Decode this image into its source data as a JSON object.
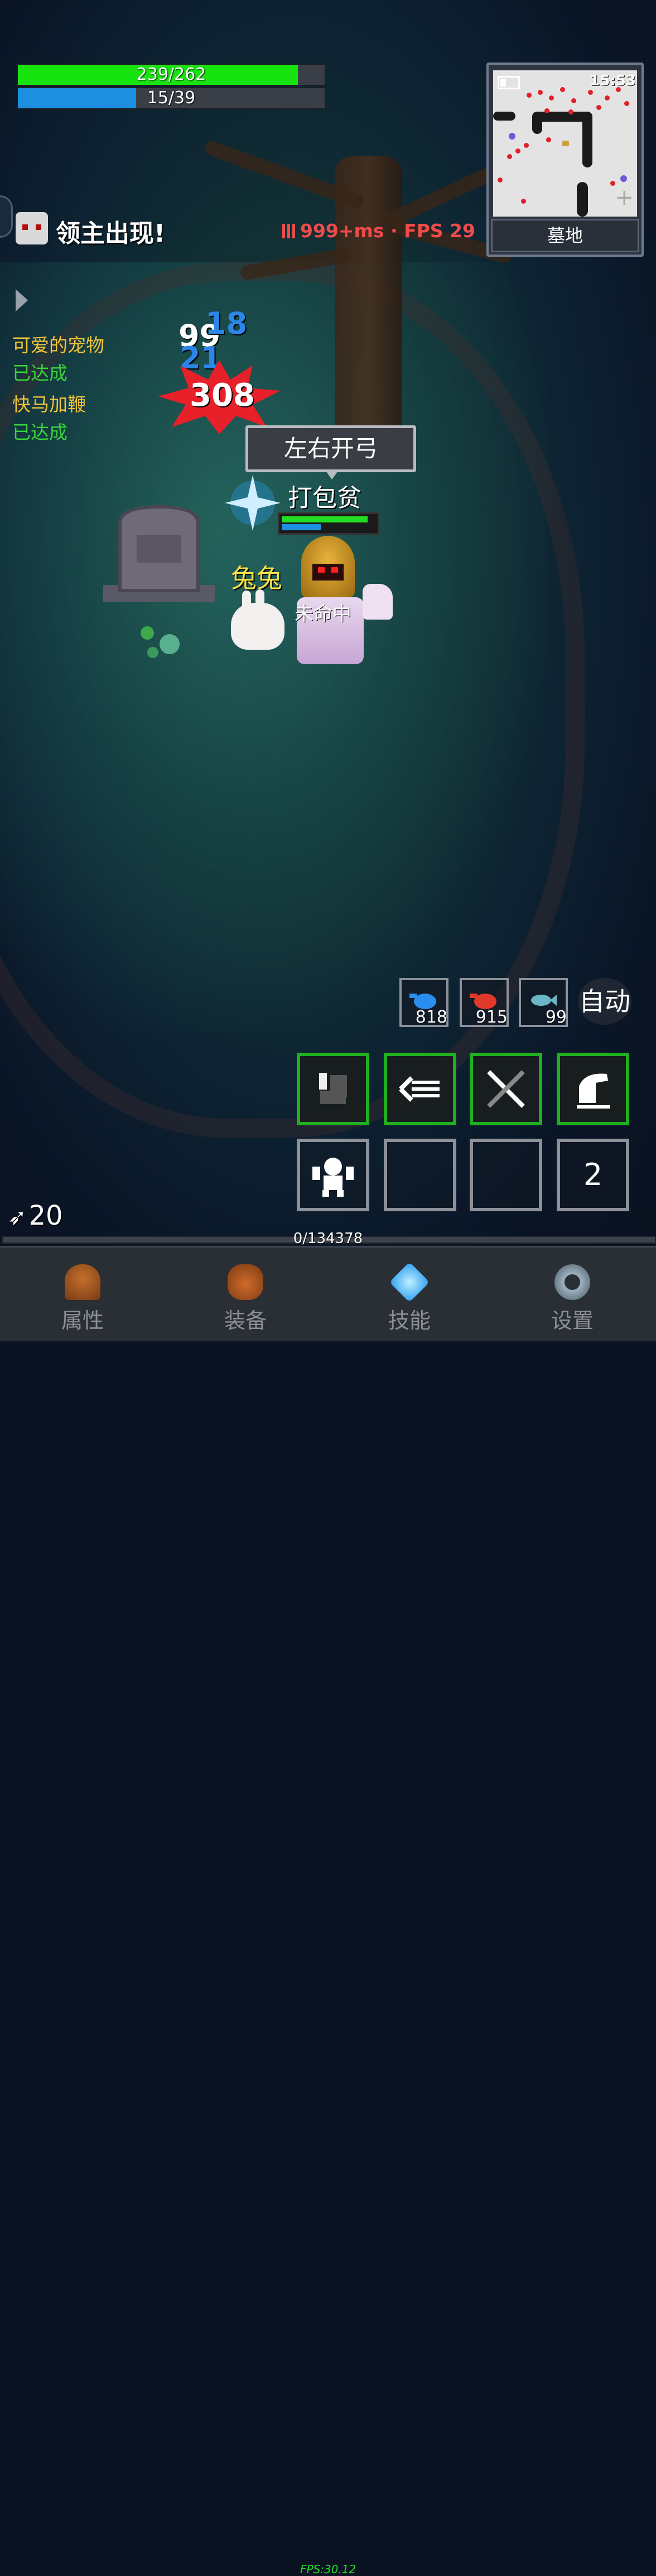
{
  "hud": {
    "hp": {
      "value": "239/262",
      "current": 239,
      "max": 262
    },
    "mp": {
      "value": "15/39",
      "current": 15,
      "max": 39
    }
  },
  "minimap": {
    "time": "15:53",
    "location": "墓地"
  },
  "boss_alert": "领主出现!",
  "network": {
    "ping_fps": "999+ms · FPS 29"
  },
  "quests": [
    {
      "name": "可爱的宠物",
      "status": "已达成"
    },
    {
      "name": "快马加鞭",
      "status": "已达成"
    }
  ],
  "damage_numbers": {
    "white": "99",
    "blue_1": "18",
    "blue_2": "21",
    "crit": "308"
  },
  "player": {
    "speech": "左右开弓",
    "name": "打包贫",
    "status": "未命中"
  },
  "pet": {
    "name": "兔兔"
  },
  "items": [
    {
      "icon": "blue-potion-icon",
      "count": "818",
      "color": "#2a8df0"
    },
    {
      "icon": "red-potion-icon",
      "count": "915",
      "color": "#e23a2a"
    },
    {
      "icon": "fish-icon",
      "count": "99",
      "color": "#6ab6c6"
    }
  ],
  "auto_label": "自动",
  "skills": {
    "row1": [
      "fist-skill-icon",
      "arrow-volley-skill-icon",
      "crossed-swords-skill-icon",
      "horse-skill-icon"
    ],
    "row2_icon": "summon-skill-icon",
    "count": "2"
  },
  "arrows": {
    "count": "20"
  },
  "xp": {
    "value": "0/134378"
  },
  "nav": [
    {
      "label": "属性",
      "icon": "helmet-icon"
    },
    {
      "label": "装备",
      "icon": "bag-icon"
    },
    {
      "label": "技能",
      "icon": "gem-icon"
    },
    {
      "label": "设置",
      "icon": "gear-icon"
    }
  ],
  "fps_footer": "FPS:30.12"
}
